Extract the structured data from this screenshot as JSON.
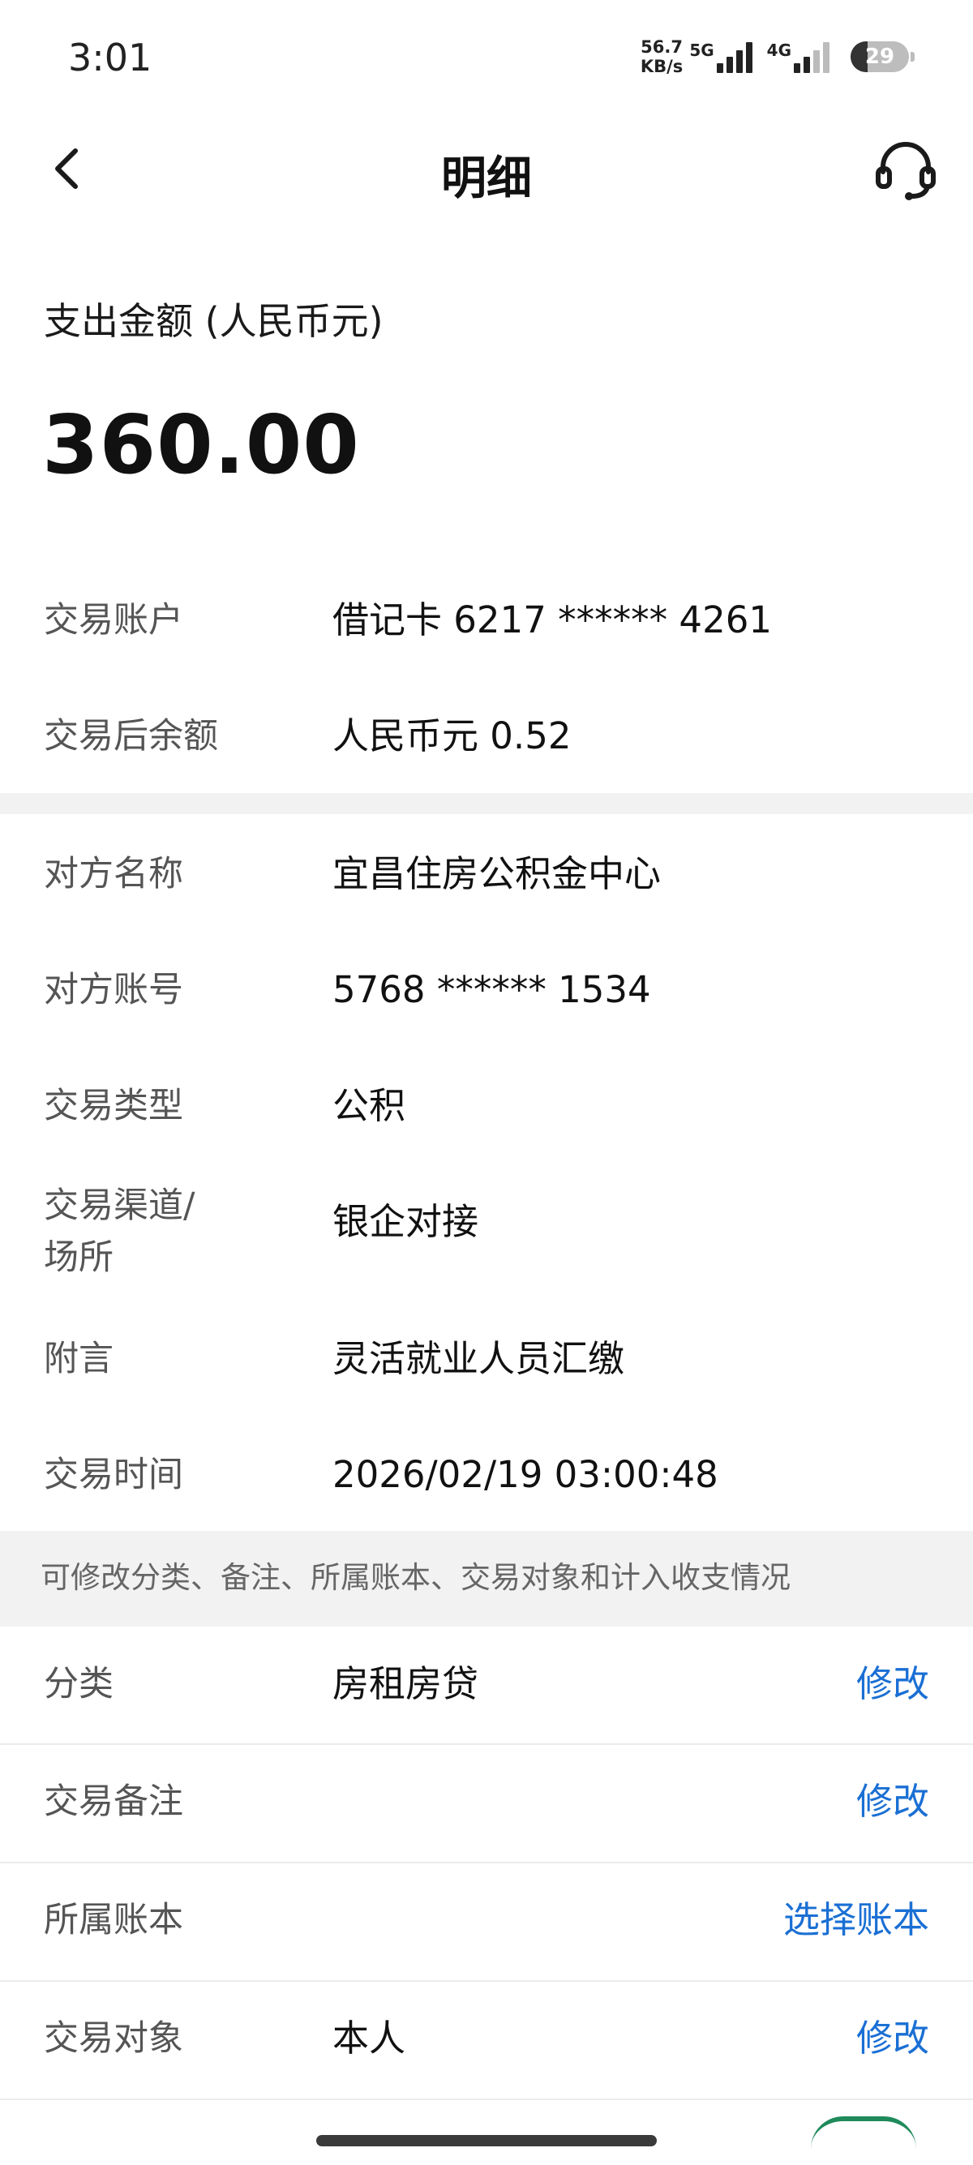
{
  "status_bar": {
    "time": "3:01",
    "speed_value": "56.7",
    "speed_unit": "KB/s",
    "network_1": "5G",
    "network_2": "4G",
    "battery": "29",
    "battery_level": 0.29
  },
  "header": {
    "title": "明细",
    "back_icon": "chevron-left-icon",
    "support_icon": "headset-icon"
  },
  "amount": {
    "label": "支出金额 (人民币元)",
    "value": "360.00"
  },
  "details_primary": [
    {
      "label": "交易账户",
      "value": "借记卡 6217 ****** 4261"
    },
    {
      "label": "交易后余额",
      "value": "人民币元 0.52"
    }
  ],
  "details_secondary": [
    {
      "label": "对方名称",
      "value": "宜昌住房公积金中心"
    },
    {
      "label": "对方账号",
      "value": "5768 ****** 1534"
    },
    {
      "label": "交易类型",
      "value": "公积"
    },
    {
      "label_line1": "交易渠道/",
      "label_line2": "场所",
      "value": "银企对接"
    },
    {
      "label": "附言",
      "value": "灵活就业人员汇缴"
    },
    {
      "label": "交易时间",
      "value": "2026/02/19 03:00:48"
    }
  ],
  "hint": "可修改分类、备注、所属账本、交易对象和计入收支情况",
  "editable": [
    {
      "label": "分类",
      "value": "房租房贷",
      "action": "修改"
    },
    {
      "label": "交易备注",
      "value": "",
      "action": "修改"
    },
    {
      "label": "所属账本",
      "value": "",
      "action": "选择账本"
    },
    {
      "label": "交易对象",
      "value": "本人",
      "action": "修改"
    }
  ],
  "colors": {
    "accent": "#1a6fd4",
    "band": "#f2f2f2",
    "label": "#555555",
    "text": "#111111"
  }
}
